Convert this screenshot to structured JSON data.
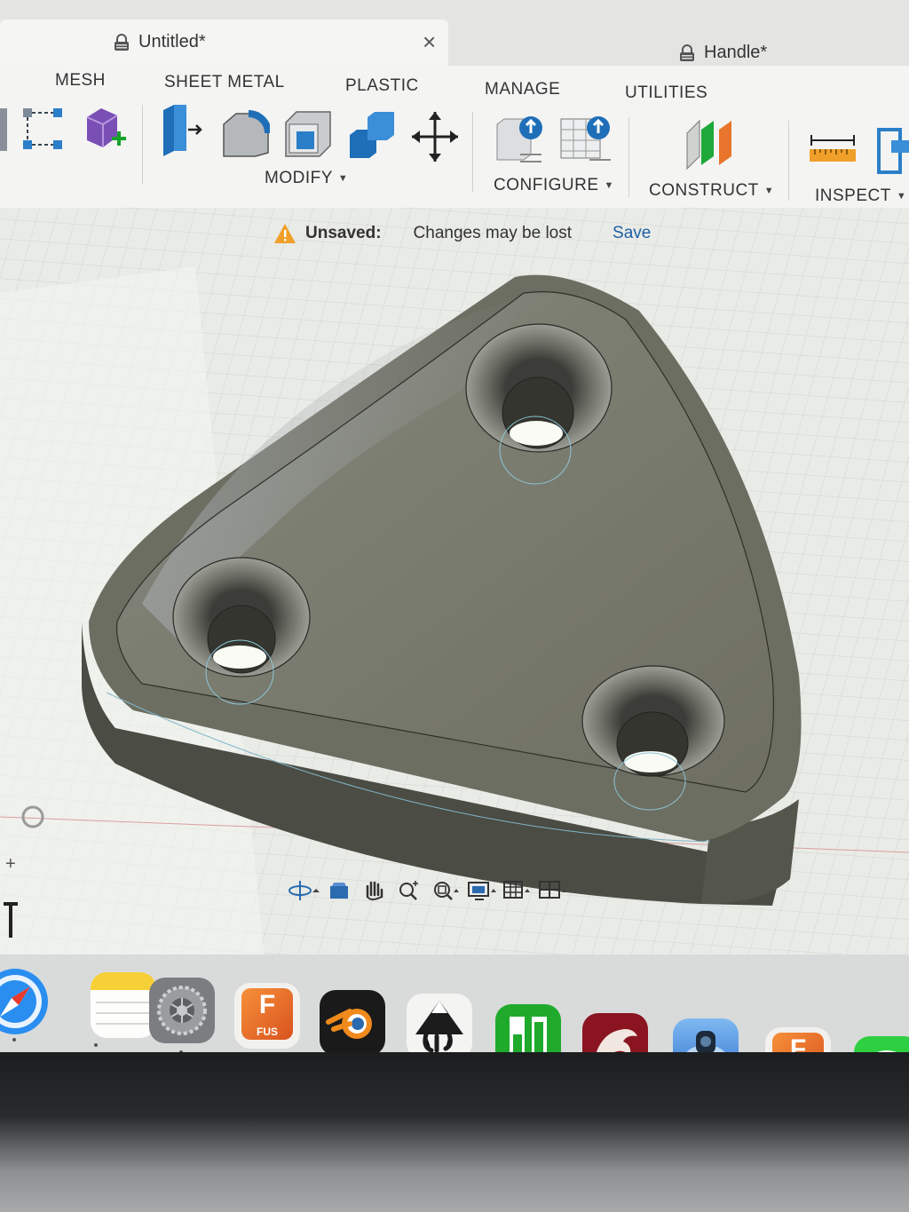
{
  "tabs": [
    {
      "label": "Untitled*",
      "close": "×"
    },
    {
      "label": "Handle*"
    }
  ],
  "menus": [
    "MESH",
    "SHEET METAL",
    "PLASTIC",
    "MANAGE",
    "UTILITIES"
  ],
  "groups": {
    "modify": "MODIFY",
    "configure": "CONFIGURE",
    "construct": "CONSTRUCT",
    "inspect": "INSPECT"
  },
  "banner": {
    "title": "Unsaved:",
    "message": "Changes may be lost",
    "save": "Save"
  },
  "misc": {
    "plus": "+"
  },
  "dock": {
    "fusion_tile_letter": "F",
    "fusion_tile_caption": "FUS",
    "icons": [
      "safari-icon",
      "notes-icon",
      "system-settings-icon",
      "fusion-360-icon",
      "blender-icon",
      "inkscape-icon",
      "numbers-icon",
      "dragon-app-icon",
      "camera-app-icon",
      "fusion-360-icon",
      "messages-icon"
    ]
  },
  "colors": {
    "accent_blue": "#1e5fa8",
    "warning_orange": "#f0a02a",
    "model_gray": "#77786a"
  }
}
